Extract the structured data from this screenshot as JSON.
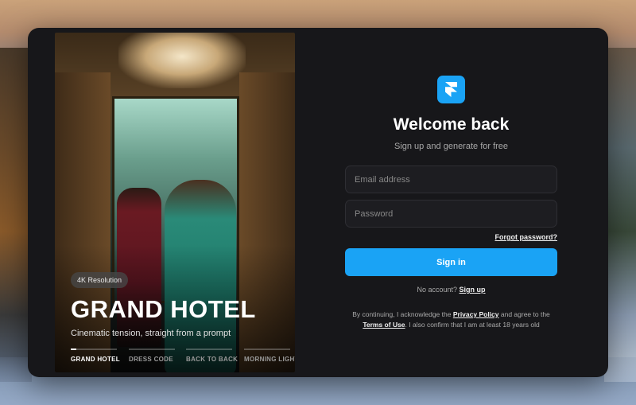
{
  "hero": {
    "badge": "4K Resolution",
    "title": "GRAND HOTEL",
    "subtitle": "Cinematic tension, straight from a prompt",
    "scenes": [
      {
        "label": "GRAND HOTEL",
        "active": true
      },
      {
        "label": "DRESS CODE",
        "active": false
      },
      {
        "label": "BACK TO BACK",
        "active": false
      },
      {
        "label": "MORNING LIGHT",
        "active": false
      }
    ]
  },
  "auth": {
    "logo_icon": "framer-logo-icon",
    "title": "Welcome back",
    "subtitle": "Sign up and generate for free",
    "email_placeholder": "Email address",
    "password_placeholder": "Password",
    "forgot_label": "Forgot password?",
    "signin_label": "Sign in",
    "no_account_text": "No account?",
    "signup_label": "Sign up",
    "legal": {
      "prefix": "By continuing, I acknowledge the",
      "privacy_label": "Privacy Policy",
      "middle": "and agree to the",
      "terms_label": "Terms of Use",
      "suffix": ". I also confirm that I am at least 18 years old"
    }
  },
  "colors": {
    "accent": "#1aa3f5",
    "card_bg": "#17171a",
    "field_bg": "#1d1d21"
  }
}
